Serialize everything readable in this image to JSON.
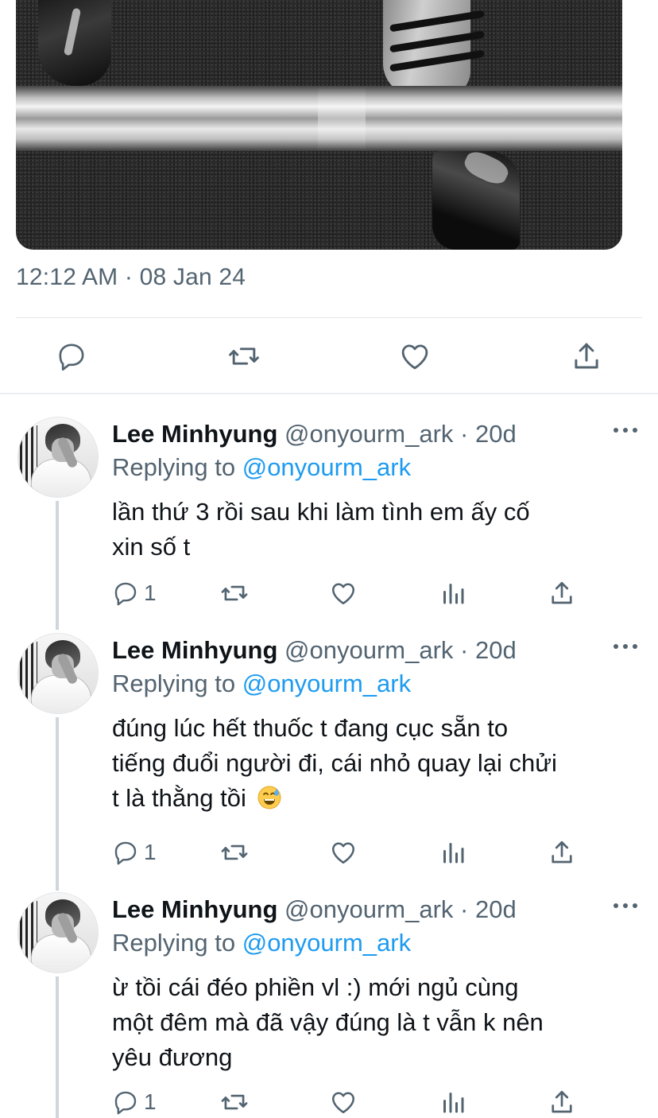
{
  "main_tweet": {
    "timestamp": "12:12 AM · 08 Jan 24",
    "actions": [
      "reply-icon",
      "retweet-icon",
      "like-icon",
      "share-icon"
    ]
  },
  "replies": [
    {
      "name": "Lee Minhyung",
      "handle": "@onyourm_ark",
      "separator": "·",
      "age": "20d",
      "replying_prefix": "Replying to",
      "replying_to": "@onyourm_ark",
      "lines": [
        "lần thứ 3 rồi sau khi làm tình em ấy cố",
        "xin số t"
      ],
      "reply_count": "1"
    },
    {
      "name": "Lee Minhyung",
      "handle": "@onyourm_ark",
      "separator": "·",
      "age": "20d",
      "replying_prefix": "Replying to",
      "replying_to": "@onyourm_ark",
      "lines": [
        "đúng lúc hết thuốc t đang cục sẵn to",
        "tiếng đuổi người đi, cái nhỏ quay lại chửi",
        "t là thằng tồi"
      ],
      "emoji": "grinning-face-with-sweat",
      "reply_count": "1"
    },
    {
      "name": "Lee Minhyung",
      "handle": "@onyourm_ark",
      "separator": "·",
      "age": "20d",
      "replying_prefix": "Replying to",
      "replying_to": "@onyourm_ark",
      "lines": [
        "ừ tồi cái đéo phiền vl :) mới ngủ cùng",
        "một đêm mà đã vậy đúng là t vẫn k nên",
        "yêu đương"
      ],
      "reply_count": "1"
    }
  ],
  "colors": {
    "text": "#0f1419",
    "secondary": "#536471",
    "link": "#1d9bf0",
    "divider": "#e4e8ec",
    "thread_line": "#d0d6db"
  }
}
